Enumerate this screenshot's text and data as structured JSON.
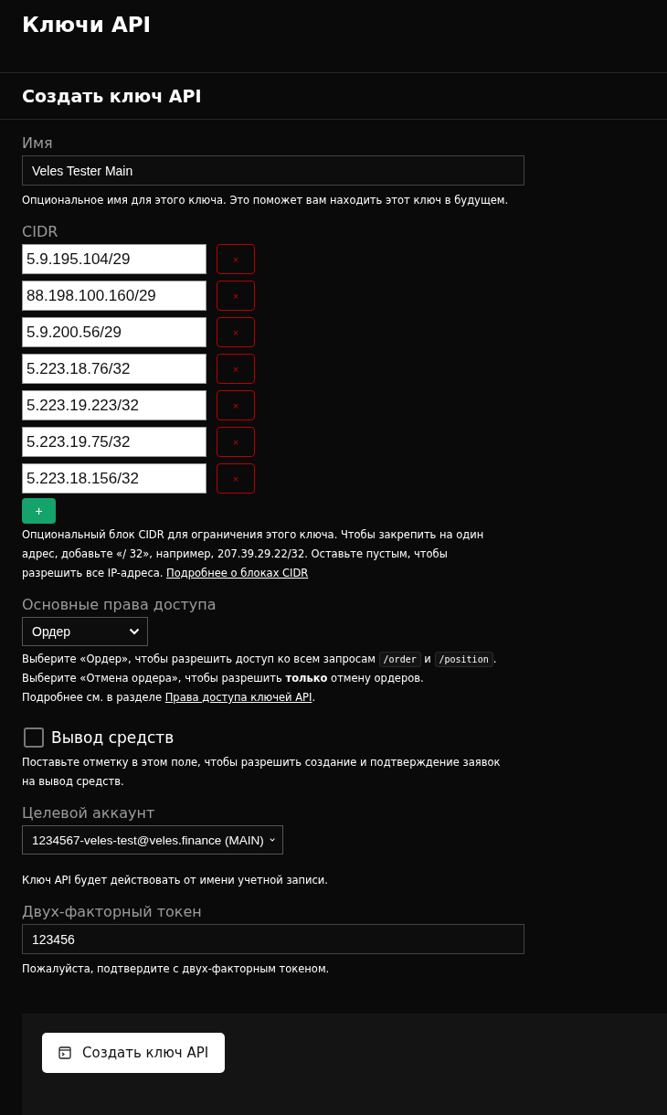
{
  "page_title": "Ключи API",
  "section_title": "Создать ключ API",
  "name_field": {
    "label": "Имя",
    "value": "Veles Tester Main",
    "help": "Опциональное имя для этого ключа. Это поможет вам находить этот ключ в будущем."
  },
  "cidr": {
    "label": "CIDR",
    "entries": [
      {
        "value": "5.9.195.104/29",
        "remove": "×"
      },
      {
        "value": "88.198.100.160/29",
        "remove": "×"
      },
      {
        "value": "5.9.200.56/29",
        "remove": "×"
      },
      {
        "value": "5.223.18.76/32",
        "remove": "×"
      },
      {
        "value": "5.223.19.223/32",
        "remove": "×"
      },
      {
        "value": "5.223.19.75/32",
        "remove": "×"
      },
      {
        "value": "5.223.18.156/32",
        "remove": "×"
      }
    ],
    "add": "+",
    "help": [
      {
        "kind": "text",
        "text": "Опциональный блок CIDR для ограничения этого ключа. Чтобы закрепить на один адрес, добавьте «/ 32», например, 207.39.29.22/32. Оставьте пустым, чтобы разрешить все IP-адреса. "
      },
      {
        "kind": "link",
        "text": "Подробнее о блоках CIDR"
      }
    ]
  },
  "permissions": {
    "label": "Основные права доступа",
    "value": "Ордер",
    "help": [
      [
        {
          "kind": "text",
          "text": "Выберите «Ордер», чтобы разрешить доступ ко всем запросам "
        },
        {
          "kind": "code",
          "text": "/order"
        },
        {
          "kind": "text",
          "text": " и "
        },
        {
          "kind": "code",
          "text": "/position"
        },
        {
          "kind": "text",
          "text": "."
        }
      ],
      [
        {
          "kind": "text",
          "text": "Выберите «Отмена ордера», чтобы разрешить **только** отмену ордеров."
        }
      ],
      [
        {
          "kind": "text",
          "text": "Подробнее см. в разделе "
        },
        {
          "kind": "link",
          "text": "Права доступа ключей API"
        },
        {
          "kind": "text",
          "text": "."
        }
      ]
    ]
  },
  "withdraw": {
    "label": "Вывод средств",
    "checked": false,
    "help": "Поставьте отметку в этом поле, чтобы разрешить создание и подтверждение заявок на вывод средств."
  },
  "account": {
    "label": "Целевой аккаунт",
    "value": "1234567-veles-test@veles.finance (MAIN)",
    "help": "Ключ API будет действовать от имени учетной записи."
  },
  "token": {
    "label": "Двух-факторный токен",
    "value": "123456",
    "help": "Пожалуйста, подтвердите с двух-факторным токеном."
  },
  "submit": "Создать ключ API"
}
